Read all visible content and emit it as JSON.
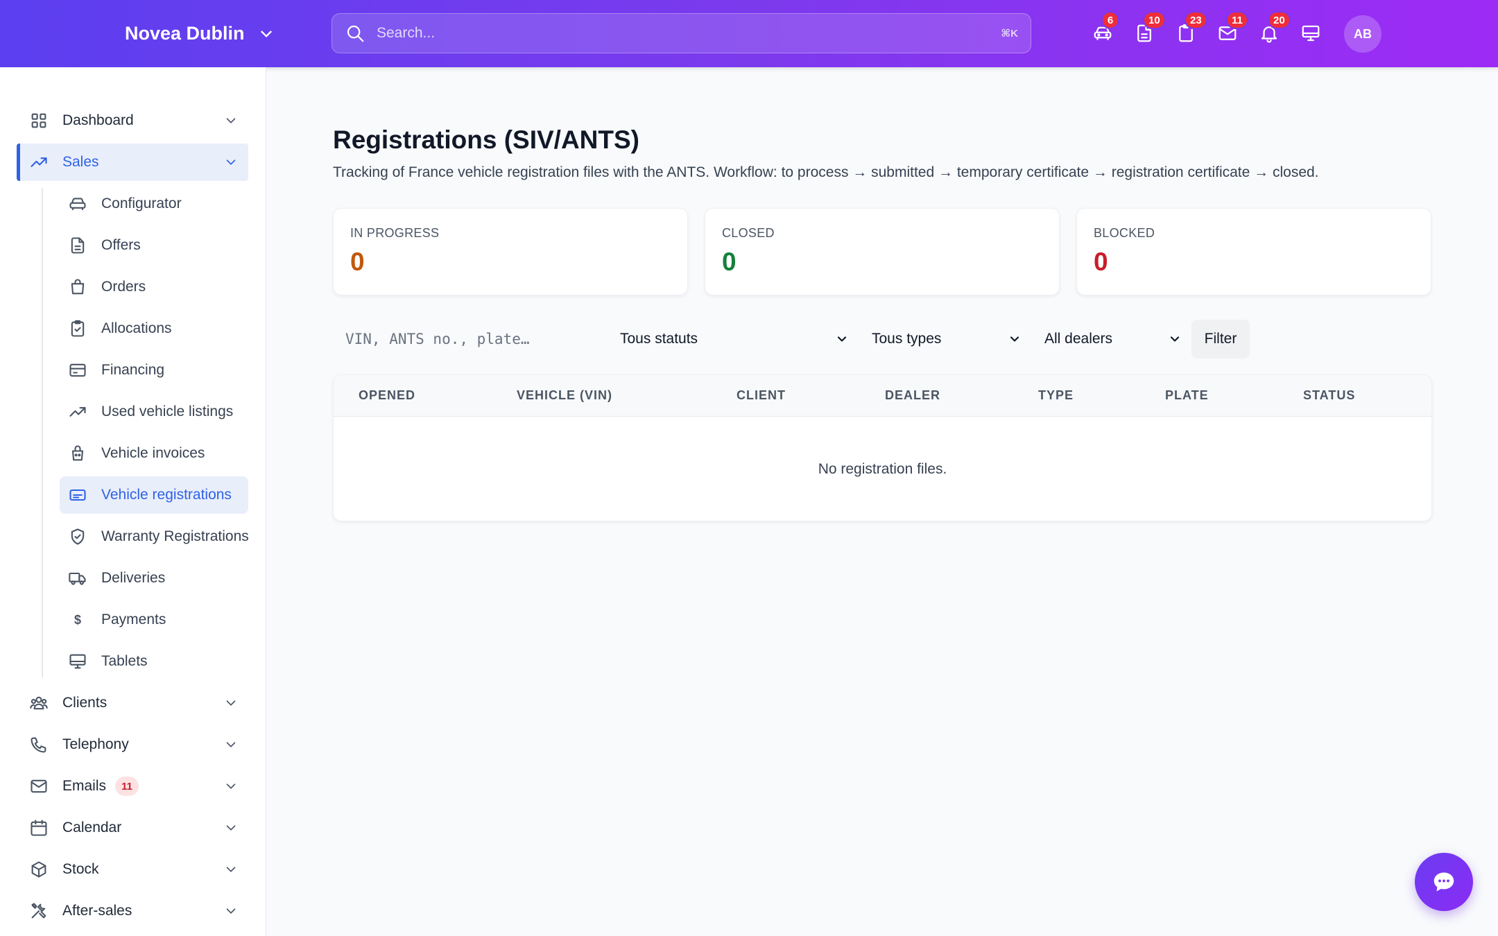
{
  "topbar": {
    "brand": "Novea Dublin",
    "search_placeholder": "Search...",
    "search_shortcut": "⌘K",
    "icons": [
      {
        "name": "car-icon",
        "badge": "6"
      },
      {
        "name": "document-icon",
        "badge": "10"
      },
      {
        "name": "clipboard-icon",
        "badge": "23"
      },
      {
        "name": "mail-icon",
        "badge": "11"
      },
      {
        "name": "bell-icon",
        "badge": "20"
      },
      {
        "name": "monitor-icon",
        "badge": ""
      }
    ],
    "avatar": "AB"
  },
  "sidebar": {
    "sections": [
      {
        "label": "Dashboard",
        "icon": "grid-icon"
      },
      {
        "label": "Sales",
        "icon": "trending-up-icon",
        "active": true
      },
      {
        "label": "Clients",
        "icon": "users-icon"
      },
      {
        "label": "Telephony",
        "icon": "phone-icon"
      },
      {
        "label": "Emails",
        "icon": "mail-icon",
        "badge": "11"
      },
      {
        "label": "Calendar",
        "icon": "calendar-icon"
      },
      {
        "label": "Stock",
        "icon": "box-icon"
      },
      {
        "label": "After-sales",
        "icon": "tools-icon"
      }
    ],
    "sales_items": [
      {
        "label": "Configurator",
        "icon": "car-icon"
      },
      {
        "label": "Offers",
        "icon": "document-icon"
      },
      {
        "label": "Orders",
        "icon": "bag-icon"
      },
      {
        "label": "Allocations",
        "icon": "clipboard-check-icon"
      },
      {
        "label": "Financing",
        "icon": "credit-card-icon"
      },
      {
        "label": "Used vehicle listings",
        "icon": "trending-up-icon"
      },
      {
        "label": "Vehicle invoices",
        "icon": "receipt-icon"
      },
      {
        "label": "Vehicle registrations",
        "icon": "id-card-icon",
        "active": true
      },
      {
        "label": "Warranty Registrations",
        "icon": "shield-check-icon"
      },
      {
        "label": "Deliveries",
        "icon": "truck-icon"
      },
      {
        "label": "Payments",
        "icon": "dollar-icon",
        "glyph": "$"
      },
      {
        "label": "Tablets",
        "icon": "monitor-icon"
      }
    ]
  },
  "main": {
    "title": "Registrations (SIV/ANTS)",
    "description": "Tracking of France vehicle registration files with the ANTS. Workflow: to process → submitted → temporary certificate → registration certificate → closed.",
    "stats": [
      {
        "label": "IN PROGRESS",
        "value": "0",
        "color": "#c2570c"
      },
      {
        "label": "CLOSED",
        "value": "0",
        "color": "#15803d"
      },
      {
        "label": "BLOCKED",
        "value": "0",
        "color": "#c81e2a"
      }
    ],
    "filters": {
      "search_placeholder": "VIN, ANTS no., plate…",
      "status": "Tous statuts",
      "type": "Tous types",
      "dealer": "All dealers",
      "button": "Filter"
    },
    "table": {
      "columns": [
        "OPENED",
        "VEHICLE (VIN)",
        "CLIENT",
        "DEALER",
        "TYPE",
        "PLATE",
        "STATUS"
      ],
      "empty_text": "No registration files."
    }
  },
  "fab": {
    "icon": "chat-icon"
  },
  "colors": {
    "accent": "#2f62e4",
    "topbar_start": "#5b3ff0",
    "topbar_end": "#9d2bf5"
  }
}
